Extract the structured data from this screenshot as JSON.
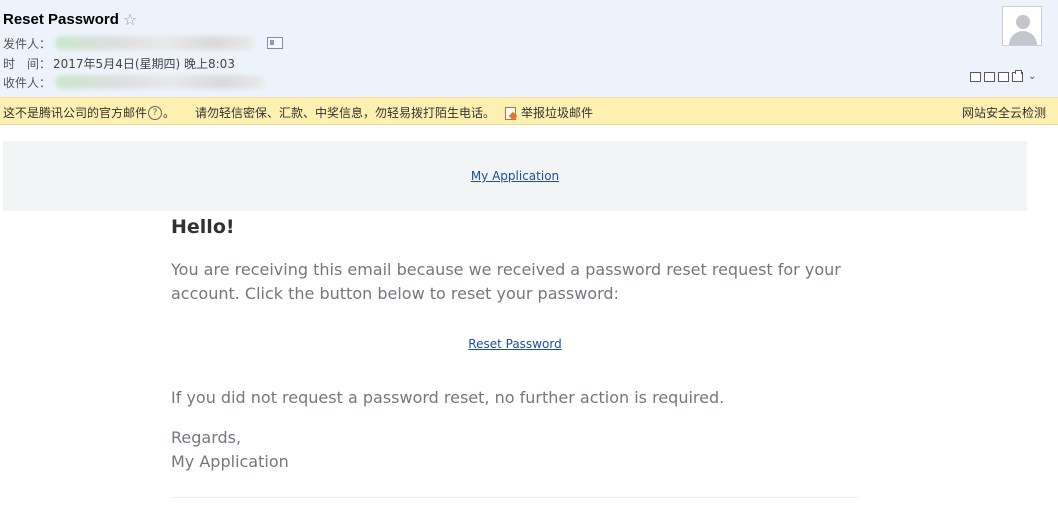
{
  "header": {
    "subject": "Reset Password",
    "star": "☆",
    "from_label": "发件人：",
    "time_label": "时　间：",
    "time_value": "2017年5月4日(星期四) 晚上8:03",
    "to_label": "收件人："
  },
  "warning_bar": {
    "message_part1": "这不是腾讯公司的官方邮件",
    "help_mark": "?",
    "message_part2": "。",
    "message_part3": "请勿轻信密保、汇款、中奖信息，勿轻易拨打陌生电话。",
    "report_label": "举报垃圾邮件",
    "security_check": "网站安全云检测"
  },
  "email": {
    "app_name_link": "My Application",
    "greeting": "Hello!",
    "intro": "You are receiving this email because we received a password reset request for your account. Click the button below to reset your password:",
    "action_link": "Reset Password",
    "outro": "If you did not request a password reset, no further action is required.",
    "regards": "Regards,",
    "signature": "My Application"
  },
  "colors": {
    "header_bg": "#eef3fb",
    "warning_bg": "#fdf0b0",
    "banner_bg": "#f2f4f6",
    "link": "#1d4ea0",
    "body_text": "#74787e",
    "heading_text": "#2f3133"
  },
  "icons": [
    "star-icon",
    "contact-card-icon",
    "avatar-icon",
    "new-window-icon",
    "document-icon",
    "folder-icon",
    "print-icon",
    "chevron-down-icon",
    "help-icon",
    "report-spam-icon"
  ]
}
